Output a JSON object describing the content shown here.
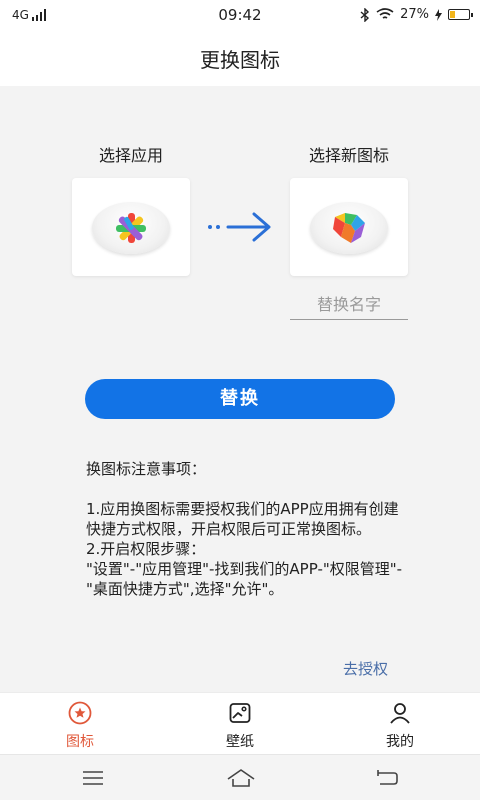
{
  "status_bar": {
    "network": "4G",
    "time": "09:42",
    "battery": "27%",
    "battery_level": 0.27,
    "icons": [
      "signal-bars-icon",
      "bluetooth-icon",
      "wifi-icon",
      "charging-bolt-icon",
      "battery-icon"
    ]
  },
  "header": {
    "title": "更换图标"
  },
  "select_app": {
    "label": "选择应用",
    "icon": "app-logo-icon"
  },
  "select_new_icon": {
    "label": "选择新图标",
    "icon": "new-app-icon"
  },
  "rename": {
    "placeholder": "替换名字",
    "value": ""
  },
  "replace_button": {
    "label": "替换"
  },
  "notes": {
    "title": "换图标注意事项：",
    "body": "1.应用换图标需要授权我们的APP应用拥有创建快捷方式权限，开启权限后可正常换图标。\n2.开启权限步骤：\n\"设置\"-\"应用管理\"-找到我们的APP-\"权限管理\"-\"桌面快捷方式\",选择\"允许\"。"
  },
  "authorize_link": "去授权",
  "tabs": [
    {
      "label": "图标",
      "icon": "star-circle-icon",
      "active": true
    },
    {
      "label": "壁纸",
      "icon": "wallpaper-icon",
      "active": false
    },
    {
      "label": "我的",
      "icon": "person-icon",
      "active": false
    }
  ],
  "colors": {
    "accent": "#1273e6",
    "active_tab": "#e0583a",
    "link": "#4a6ea8",
    "battery": "#f2b51b",
    "background": "#f3f3f3"
  },
  "system_nav": [
    "menu-icon",
    "home-icon",
    "back-icon"
  ]
}
